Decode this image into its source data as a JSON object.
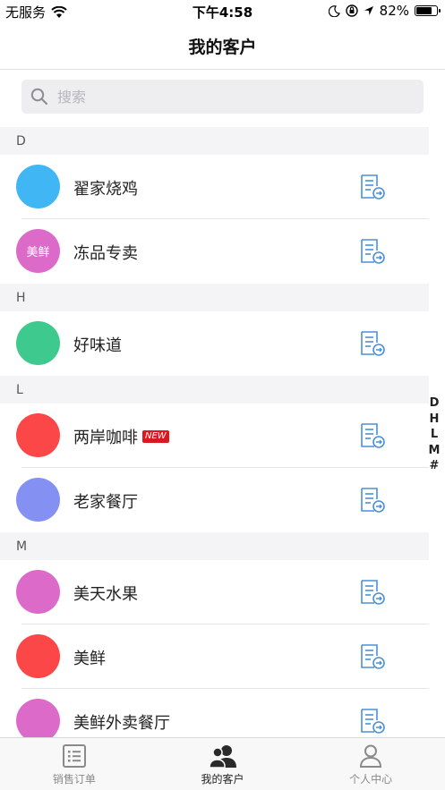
{
  "status_bar": {
    "carrier": "无服务",
    "time": "下午4:58",
    "battery": "82%",
    "battery_level": 0.82
  },
  "nav": {
    "title": "我的客户"
  },
  "search": {
    "placeholder": "搜索"
  },
  "sections": [
    {
      "letter": "D",
      "customers": [
        {
          "name": "翟家烧鸡",
          "avatar_text": "",
          "avatar_color": "#41b6f5",
          "new": false
        },
        {
          "name": "冻品专卖",
          "avatar_text": "美鲜",
          "avatar_color": "#db6ac8",
          "new": false
        }
      ]
    },
    {
      "letter": "H",
      "customers": [
        {
          "name": "好味道",
          "avatar_text": "",
          "avatar_color": "#3ec98e",
          "new": false
        }
      ]
    },
    {
      "letter": "L",
      "customers": [
        {
          "name": "两岸咖啡",
          "avatar_text": "",
          "avatar_color": "#fb4747",
          "new": true
        },
        {
          "name": "老家餐厅",
          "avatar_text": "",
          "avatar_color": "#8491f3",
          "new": false
        }
      ]
    },
    {
      "letter": "M",
      "customers": [
        {
          "name": "美天水果",
          "avatar_text": "",
          "avatar_color": "#db6ac8",
          "new": false
        },
        {
          "name": "美鲜",
          "avatar_text": "",
          "avatar_color": "#fb4747",
          "new": false
        },
        {
          "name": "美鲜外卖餐厅",
          "avatar_text": "",
          "avatar_color": "#db6ac8",
          "new": false
        }
      ]
    }
  ],
  "new_badge": "NEW",
  "index_letters": [
    "D",
    "H",
    "L",
    "M",
    "#"
  ],
  "tabs": [
    {
      "label": "销售订单",
      "icon": "list-icon",
      "active": false
    },
    {
      "label": "我的客户",
      "icon": "customers-icon",
      "active": true
    },
    {
      "label": "个人中心",
      "icon": "person-icon",
      "active": false
    }
  ],
  "colors": {
    "icon_blue": "#4a90d9",
    "badge_red": "#d9191f"
  }
}
